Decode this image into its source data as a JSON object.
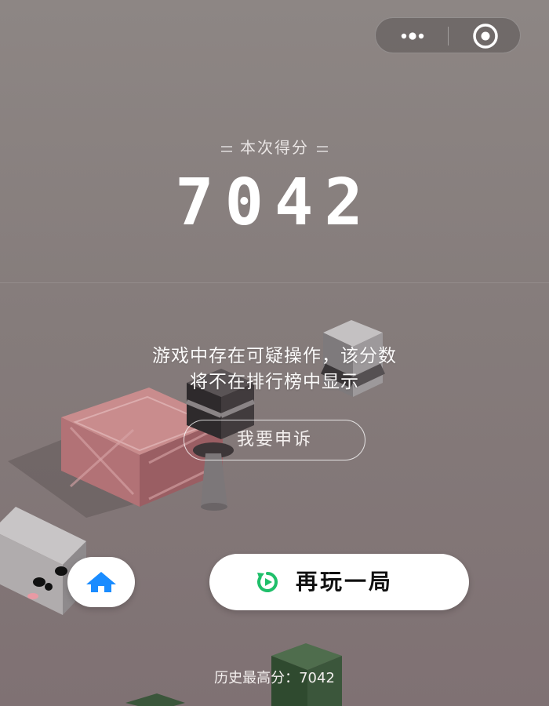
{
  "score_label": "本次得分",
  "score": "7042",
  "warning": {
    "line1": "游戏中存在可疑操作，该分数",
    "line2": "将不在排行榜中显示"
  },
  "appeal_button": "我要申诉",
  "replay_button": "再玩一局",
  "best": {
    "label": "历史最高分：",
    "value": "7042"
  },
  "colors": {
    "accent_home": "#1a8cff",
    "accent_replay": "#1fbf6a"
  },
  "icons": {
    "home": "home-icon",
    "replay": "replay-icon",
    "more": "more-dots-icon",
    "close": "close-target-icon"
  }
}
